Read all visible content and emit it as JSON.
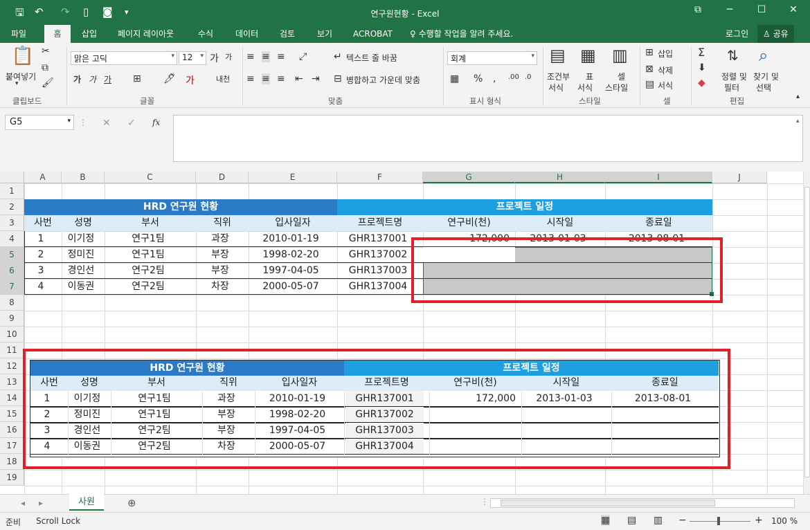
{
  "window": {
    "title": "연구원현황 - Excel",
    "controls": {
      "restore": "⧉",
      "minimize": "─",
      "maximize": "☐",
      "close": "✕"
    }
  },
  "ribbon_tabs": [
    "파일",
    "홈",
    "삽입",
    "페이지 레이아웃",
    "수식",
    "데이터",
    "검토",
    "보기",
    "ACROBAT"
  ],
  "tellme": "수행할 작업을 알려 주세요.",
  "signin": "로그인",
  "share": "공유",
  "ribbon": {
    "paste": "붙여넣기",
    "font_name": "맑은 고딕",
    "font_size": "12",
    "wrap_text": "텍스트 줄 바꿈",
    "merge_center": "병합하고 가운데 맞춤",
    "number_format": "회계",
    "cond_format": [
      "조건부",
      "서식"
    ],
    "table_format": [
      "표",
      "서식"
    ],
    "cell_style": [
      "셀",
      "스타일"
    ],
    "insert": "삽입",
    "delete": "삭제",
    "format": "서식",
    "sort_filter": [
      "정렬 및",
      "필터"
    ],
    "find_select": [
      "찾기 및",
      "선택"
    ],
    "groups": [
      "클립보드",
      "글꼴",
      "맞춤",
      "표시 형식",
      "스타일",
      "셀",
      "편집"
    ]
  },
  "formula_bar": {
    "name_box": "G5",
    "fx": "fx",
    "value": ""
  },
  "columns": [
    "A",
    "B",
    "C",
    "D",
    "E",
    "F",
    "G",
    "H",
    "I",
    "J"
  ],
  "rows": [
    "1",
    "2",
    "3",
    "4",
    "5",
    "6",
    "7",
    "8",
    "9",
    "10",
    "11",
    "12",
    "13",
    "14",
    "15",
    "16",
    "17",
    "18",
    "19"
  ],
  "table1": {
    "left_title": "HRD 연구원 현황",
    "right_title": "프로젝트 일정",
    "headers": [
      "사번",
      "성명",
      "부서",
      "직위",
      "입사일자",
      "프로젝트명",
      "연구비(천)",
      "시작일",
      "종료일"
    ],
    "rows": [
      [
        "1",
        "이기정",
        "연구1팀",
        "과장",
        "2010-01-19",
        "GHR137001",
        "172,000",
        "2013-01-03",
        "2013-08-01"
      ],
      [
        "2",
        "정미진",
        "연구1팀",
        "부장",
        "1998-02-20",
        "GHR137002",
        "",
        "",
        ""
      ],
      [
        "3",
        "경인선",
        "연구2팀",
        "부장",
        "1997-04-05",
        "GHR137003",
        "",
        "",
        ""
      ],
      [
        "4",
        "이동권",
        "연구2팀",
        "차장",
        "2000-05-07",
        "GHR137004",
        "",
        "",
        ""
      ]
    ]
  },
  "table2": {
    "left_title": "HRD 연구원 현황",
    "right_title": "프로젝트 일정",
    "headers": [
      "사번",
      "성명",
      "부서",
      "직위",
      "입사일자",
      "프로젝트명",
      "연구비(천)",
      "시작일",
      "종료일"
    ],
    "rows": [
      [
        "1",
        "이기정",
        "연구1팀",
        "과장",
        "2010-01-19",
        "GHR137001",
        "172,000",
        "2013-01-03",
        "2013-08-01"
      ],
      [
        "2",
        "정미진",
        "연구1팀",
        "부장",
        "1998-02-20",
        "GHR137002",
        "",
        "",
        ""
      ],
      [
        "3",
        "경인선",
        "연구2팀",
        "부장",
        "1997-04-05",
        "GHR137003",
        "",
        "",
        ""
      ],
      [
        "4",
        "이동권",
        "연구2팀",
        "차장",
        "2000-05-07",
        "GHR137004",
        "",
        "",
        ""
      ]
    ]
  },
  "sheet_tab": "사원",
  "status": {
    "ready": "준비",
    "scroll_lock": "Scroll Lock",
    "zoom": "100 %"
  },
  "colors": {
    "excel_green": "#217346",
    "dark_blue": "#2a7ac6",
    "light_blue": "#1e9fe0",
    "header_fill": "#dcedf9",
    "red": "#e0202a"
  }
}
